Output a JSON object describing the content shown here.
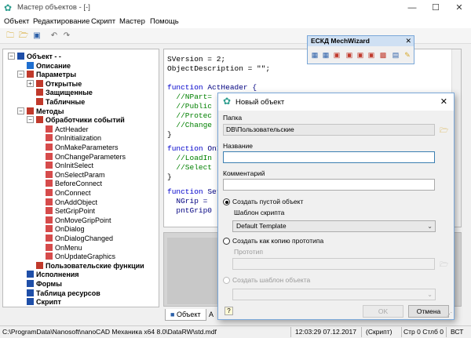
{
  "window": {
    "title": "Мастер объектов - [-]",
    "minimize": "—",
    "maximize": "☐",
    "close": "✕"
  },
  "menu": [
    "Объект",
    "Редактирование",
    "Скрипт",
    "Мастер",
    "Помощь"
  ],
  "tree": [
    {
      "label": "Объект - -",
      "bold": true,
      "expander": "−",
      "color": "#1f4fa8"
    },
    {
      "label": "Описание",
      "bold": true,
      "color": "#1f6fd0"
    },
    {
      "label": "Параметры",
      "bold": true,
      "expander": "−",
      "color": "#c0392b"
    },
    {
      "label": "Открытые",
      "bold": true,
      "expander": "+",
      "color": "#c0392b"
    },
    {
      "label": "Защищенные",
      "bold": true,
      "color": "#c0392b"
    },
    {
      "label": "Табличные",
      "bold": true,
      "color": "#c0392b"
    },
    {
      "label": "Методы",
      "bold": true,
      "expander": "−",
      "color": "#c0392b"
    },
    {
      "label": "Обработчики событий",
      "bold": true,
      "expander": "−",
      "color": "#c0392b"
    },
    {
      "label": "ActHeader",
      "color": "#d64b4b"
    },
    {
      "label": "OnInitialization",
      "color": "#d64b4b"
    },
    {
      "label": "OnMakeParameters",
      "color": "#d64b4b"
    },
    {
      "label": "OnChangeParameters",
      "color": "#d64b4b"
    },
    {
      "label": "OnInitSelect",
      "color": "#d64b4b"
    },
    {
      "label": "OnSelectParam",
      "color": "#d64b4b"
    },
    {
      "label": "BeforeConnect",
      "color": "#d64b4b"
    },
    {
      "label": "OnConnect",
      "color": "#d64b4b"
    },
    {
      "label": "OnAddObject",
      "color": "#d64b4b"
    },
    {
      "label": "SetGripPoint",
      "color": "#d64b4b"
    },
    {
      "label": "OnMoveGripPoint",
      "color": "#d64b4b"
    },
    {
      "label": "OnDialog",
      "color": "#d64b4b"
    },
    {
      "label": "OnDialogChanged",
      "color": "#d64b4b"
    },
    {
      "label": "OnMenu",
      "color": "#d64b4b"
    },
    {
      "label": "OnUpdateGraphics",
      "color": "#d64b4b"
    },
    {
      "label": "Пользовательские функции",
      "bold": true,
      "color": "#c0392b"
    },
    {
      "label": "Исполнения",
      "bold": true,
      "color": "#1f4fa8"
    },
    {
      "label": "Формы",
      "bold": true,
      "color": "#1f4fa8"
    },
    {
      "label": "Таблица ресурсов",
      "bold": true,
      "color": "#1f4fa8"
    },
    {
      "label": "Скрипт",
      "bold": true,
      "color": "#1f4fa8"
    }
  ],
  "code": {
    "l1": "SVersion = 2;",
    "l2": "ObjectDescription = \"\";",
    "l3a": "function ",
    "l3b": "ActHeader {",
    "l4": "  //NPart=",
    "l5": "  //Public",
    "l6": "  //Protec",
    "l7": "  //Change",
    "l8": "}",
    "l9a": "function ",
    "l9b": "OnI",
    "l10": "  //LoadIn",
    "l11": "  //Select",
    "l12": "}",
    "l13a": "function ",
    "l13b": "Set",
    "l14": "  NGrip =",
    "l15": "  pntGrip0"
  },
  "tabs": {
    "object": "Объект",
    "second": "А"
  },
  "status": {
    "path": "C:\\ProgramData\\Nanosoft\\nanoCAD Механика x64 8.0\\DataRW\\std.mdf",
    "time": "12:03:29  07.12.2017",
    "mode": "(Скрипт)",
    "pos": "Стр 0 Стлб 0",
    "ins": "ВСТ"
  },
  "float_toolbar": {
    "title": "ЕСКД MechWizard",
    "close": "✕"
  },
  "dialog": {
    "title": "Новый объект",
    "close": "✕",
    "folder_label": "Папка",
    "folder_value": "DB\\Пользовательские",
    "name_label": "Название",
    "name_value": "",
    "comment_label": "Комментарий",
    "comment_value": "",
    "radio_empty": "Создать пустой объект",
    "template_label": "Шаблон скрипта",
    "template_value": "Default Template",
    "radio_copy": "Создать как копию прототипа",
    "prototype_label": "Прототип",
    "prototype_value": "",
    "radio_template": "Создать шаблон объекта",
    "template2_value": "",
    "ok": "OK",
    "cancel": "Отмена",
    "help": "?"
  }
}
